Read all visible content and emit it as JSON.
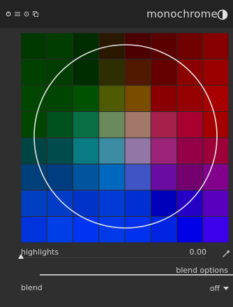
{
  "module": {
    "name": "monochrome",
    "header_icons": [
      "power-icon",
      "menu-icon",
      "reset-icon",
      "copy-icon"
    ],
    "preset_icon": "half-circle-icon"
  },
  "color_grid": {
    "rows": 8,
    "cols": 8,
    "colors": [
      [
        "#003900",
        "#003c00",
        "#002d00",
        "#2a1800",
        "#4c0000",
        "#5b0000",
        "#710000",
        "#870000"
      ],
      [
        "#004100",
        "#003d00",
        "#002d00",
        "#2e2e00",
        "#511900",
        "#640000",
        "#8b0000",
        "#9b0000"
      ],
      [
        "#004600",
        "#004600",
        "#005200",
        "#4f5b00",
        "#7a4c00",
        "#8a0000",
        "#950000",
        "#a80000"
      ],
      [
        "#004600",
        "#00521c",
        "#087044",
        "#6a8a5c",
        "#a2786a",
        "#a5204a",
        "#a8002f",
        "#a50000"
      ],
      [
        "#004444",
        "#004b4b",
        "#087c82",
        "#3c8ca3",
        "#9277a6",
        "#9a2279",
        "#930048",
        "#9d0038"
      ],
      [
        "#00407a",
        "#003c80",
        "#00569e",
        "#0067bf",
        "#4054c5",
        "#6a0ba1",
        "#74006f",
        "#81008c"
      ],
      [
        "#003ec2",
        "#003cc5",
        "#0034c9",
        "#003bd5",
        "#0030d3",
        "#0000bb",
        "#2500c5",
        "#5900bf"
      ],
      [
        "#0033db",
        "#003ee8",
        "#0034f3",
        "#003ae8",
        "#0031ec",
        "#0024e2",
        "#0000e6",
        "#3c00ea"
      ]
    ]
  },
  "highlights": {
    "label": "highlights",
    "value": "0.00",
    "position": 0.0,
    "picker_icon": "color-picker-icon"
  },
  "blend": {
    "options_label": "blend options",
    "label": "blend",
    "value": "off",
    "dropdown_icon": "chevron-down-icon"
  },
  "colors": {
    "background": "#2f2f2f",
    "header": "#232323",
    "text": "#d4d4d4",
    "circle": "#e4e4e4"
  }
}
